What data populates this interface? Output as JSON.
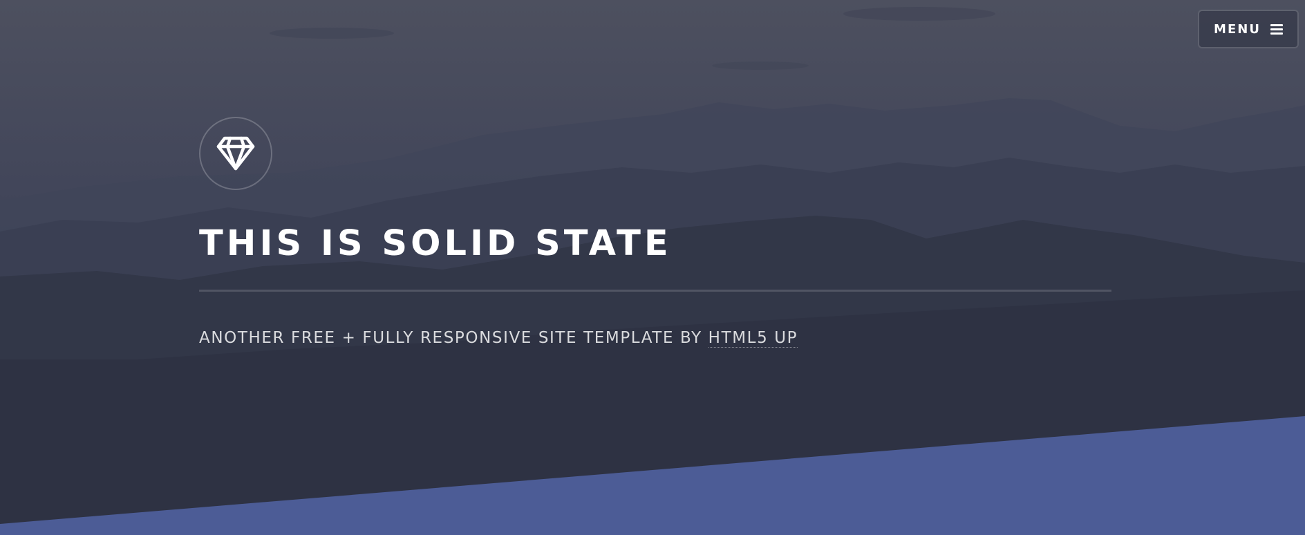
{
  "header": {
    "menu_label": "MENU",
    "menu_icon": "hamburger-icon"
  },
  "banner": {
    "logo_icon": "diamond-icon",
    "title": "THIS IS SOLID STATE",
    "tagline_text": "ANOTHER FREE + FULLY RESPONSIVE SITE TEMPLATE BY ",
    "tagline_link": "HTML5 UP"
  },
  "colors": {
    "overlay": "#2e3141",
    "accent_band": "#4c5c96",
    "text": "#ffffff"
  }
}
